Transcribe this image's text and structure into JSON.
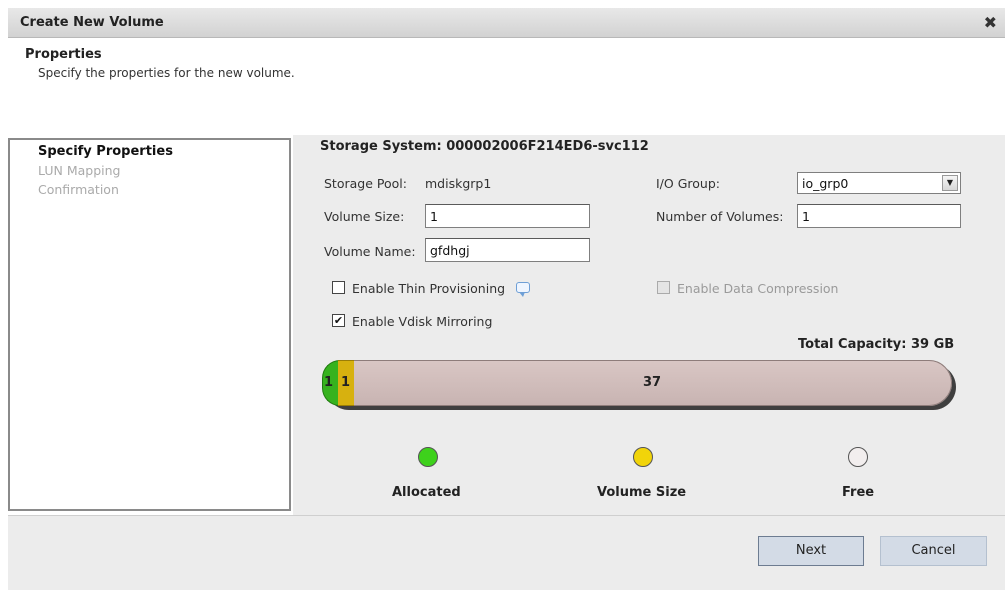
{
  "window": {
    "title": "Create New Volume",
    "close_glyph": "✖"
  },
  "header": {
    "title": "Properties",
    "description": "Specify the properties for the new volume."
  },
  "steps": [
    {
      "label": "Specify Properties",
      "state": "active"
    },
    {
      "label": "LUN Mapping",
      "state": "inactive"
    },
    {
      "label": "Confirmation",
      "state": "inactive"
    }
  ],
  "form": {
    "storage_system": "Storage System: 000002006F214ED6-svc112",
    "storage_pool_label": "Storage Pool:",
    "storage_pool_value": "mdiskgrp1",
    "volume_size_label": "Volume Size:",
    "volume_size_value": "1",
    "volume_name_label": "Volume Name:",
    "volume_name_value": "gfdhgj",
    "io_group_label": "I/O Group:",
    "io_group_value": "io_grp0",
    "num_volumes_label": "Number of Volumes:",
    "num_volumes_value": "1",
    "thin_provisioning_label": "Enable Thin Provisioning",
    "thin_provisioning_checked": false,
    "data_compression_label": "Enable Data Compression",
    "data_compression_enabled": false,
    "vdisk_mirroring_label": "Enable Vdisk Mirroring",
    "vdisk_mirroring_checked": true,
    "check_glyph": "✔"
  },
  "capacity": {
    "total_label": "Total Capacity: 39 GB",
    "allocated_value": "1",
    "volume_size_value": "1",
    "free_value": "37",
    "colors": {
      "allocated": "#36b21e",
      "volume_size": "#d7b10f",
      "free": "#d2bfbd"
    }
  },
  "legend": [
    {
      "label": "Allocated",
      "color": "#3ed11c"
    },
    {
      "label": "Volume Size",
      "color": "#f1d40a"
    },
    {
      "label": "Free",
      "color": "#f2eeee"
    }
  ],
  "buttons": {
    "next": "Next",
    "cancel": "Cancel"
  }
}
